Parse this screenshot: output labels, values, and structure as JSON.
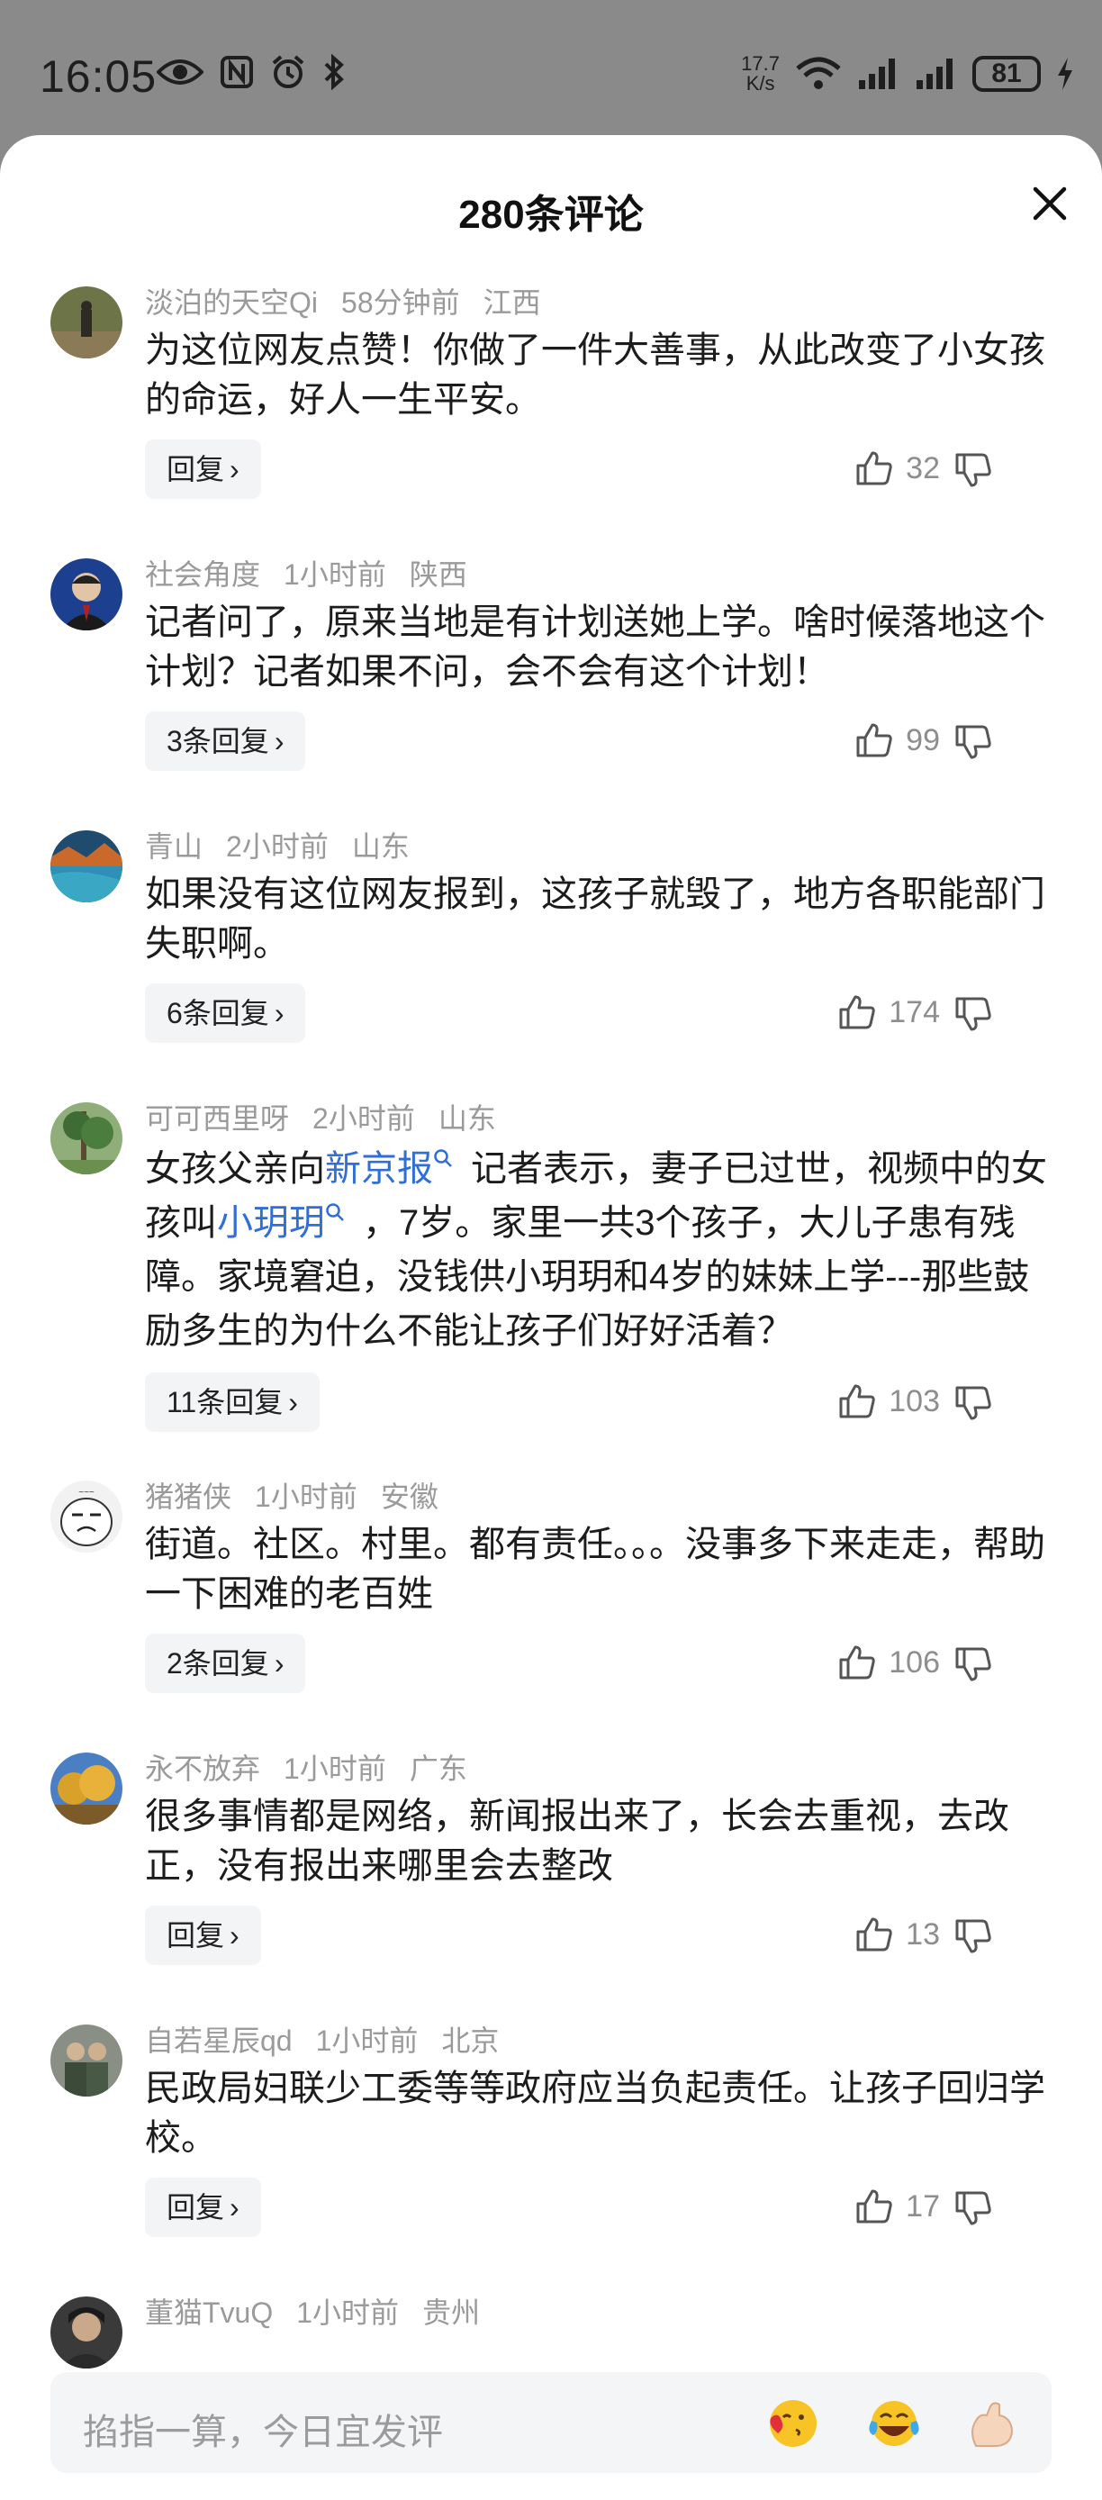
{
  "status_bar": {
    "time": "16:05",
    "net_speed_value": "17.7",
    "net_speed_unit": "K/s",
    "battery": "81",
    "icons": [
      "eye-icon",
      "nfc-icon",
      "alarm-icon",
      "bluetooth-icon",
      "wifi-icon",
      "signal-icon",
      "signal-icon",
      "charging-icon"
    ]
  },
  "sheet": {
    "title": "280条评论"
  },
  "comments": [
    {
      "user": "淡泊的天空Qi",
      "time": "58分钟前",
      "location": "江西",
      "text": "为这位网友点赞！你做了一件大善事，从此改变了小女孩的命运，好人一生平安。",
      "reply": "回复",
      "likes": "32"
    },
    {
      "user": "社会角度",
      "time": "1小时前",
      "location": "陕西",
      "text": "记者问了，原来当地是有计划送她上学。啥时候落地这个计划？记者如果不问，会不会有这个计划！",
      "reply": "3条回复",
      "likes": "99"
    },
    {
      "user": "青山",
      "time": "2小时前",
      "location": "山东",
      "text": "如果没有这位网友报到，这孩子就毁了，地方各职能部门失职啊。",
      "reply": "6条回复",
      "likes": "174"
    },
    {
      "user": "可可西里呀",
      "time": "2小时前",
      "location": "山东",
      "text_parts": [
        "女孩父亲向",
        "新京报",
        "记者表示，妻子已过世，视频中的女孩叫",
        "小玥玥",
        "，7岁。家里一共3个孩子，大儿子患有残障。家境窘迫，没钱供小玥玥和4岁的妹妹上学---那些鼓励多生的为什么不能让孩子们好好活着？"
      ],
      "reply": "11条回复",
      "likes": "103"
    },
    {
      "user": "猪猪侠",
      "time": "1小时前",
      "location": "安徽",
      "text": "街道。社区。村里。都有责任。。。没事多下来走走，帮助一下困难的老百姓",
      "reply": "2条回复",
      "likes": "106"
    },
    {
      "user": "永不放弃",
      "time": "1小时前",
      "location": "广东",
      "text": "很多事情都是网络，新闻报出来了，长会去重视，去改正，没有报出来哪里会去整改",
      "reply": "回复",
      "likes": "13"
    },
    {
      "user": "自若星辰qd",
      "time": "1小时前",
      "location": "北京",
      "text": "民政局妇联少工委等等政府应当负起责任。让孩子回归学校。",
      "reply": "回复",
      "likes": "17"
    },
    {
      "user": "董猫TvuQ",
      "time": "1小时前",
      "location": "贵州",
      "text": "",
      "reply": "",
      "likes": ""
    }
  ],
  "input": {
    "placeholder": "掐指一算，今日宜发评",
    "emojis": [
      "kiss-emoji-icon",
      "laugh-cry-emoji-icon",
      "flex-arm-emoji-icon"
    ]
  },
  "colors": {
    "link": "#2f6fd6",
    "meta": "#9a9a9a",
    "reply_bg": "#f3f4f6",
    "status_bg": "#8a8a8a"
  }
}
